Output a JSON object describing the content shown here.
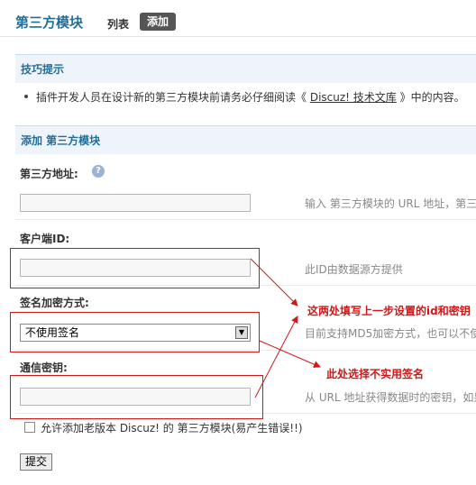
{
  "header": {
    "title": "第三方模块",
    "tabs": [
      {
        "label": "列表"
      },
      {
        "label": "添加"
      }
    ]
  },
  "tips": {
    "title": "技巧提示",
    "text_before": "插件开发人员在设计新的第三方模块前请务必仔细阅读《 ",
    "link_text": "Discuz! 技术文库",
    "text_after": " 》中的内容。"
  },
  "form": {
    "title": "添加 第三方模块",
    "fields": {
      "url": {
        "label": "第三方地址:",
        "value": "",
        "hint": "输入 第三方模块的 URL 地址，第三"
      },
      "client_id": {
        "label": "客户端ID:",
        "value": "",
        "hint": "此ID由数据源方提供"
      },
      "sign": {
        "label": "签名加密方式:",
        "selected": "不使用签名",
        "hint": "目前支持MD5加密方式，也可以不使"
      },
      "secret": {
        "label": "通信密钥:",
        "value": "",
        "hint": "从 URL 地址获得数据时的密钥，如果"
      }
    },
    "allow_old": {
      "label": "允许添加老版本 Discuz! 的 第三方模块(易产生错误!!)"
    },
    "submit_label": "提交"
  },
  "annotations": {
    "note_id_secret": "这两处填写上一步设置的id和密钥",
    "note_no_sign": "此处选择不实用签名"
  },
  "colors": {
    "accent": "#1f6e9c",
    "section_bg": "#eef4fa",
    "annotation": "#d01818"
  }
}
